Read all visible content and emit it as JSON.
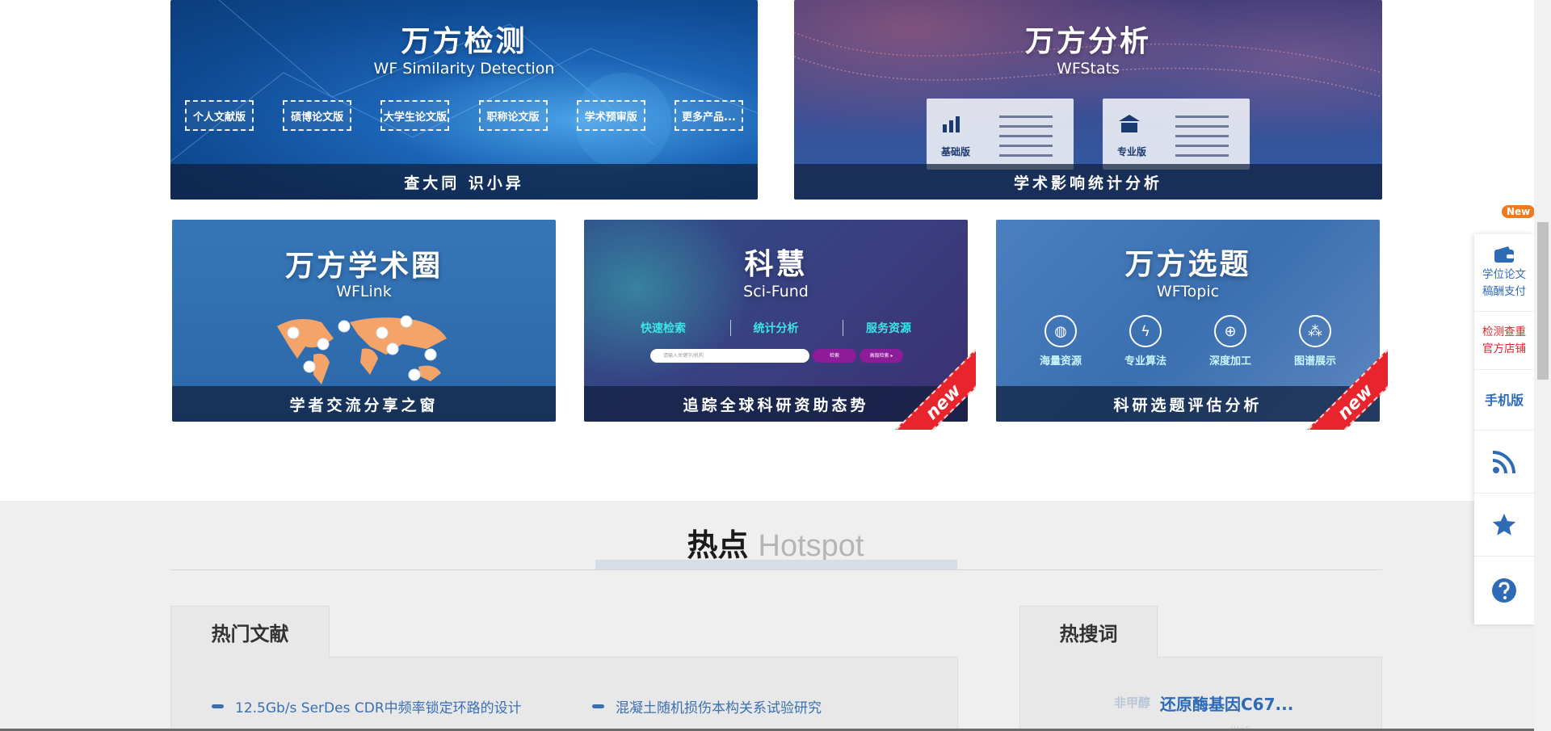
{
  "cards": {
    "detect": {
      "title": "万方检测",
      "subtitle": "WF Similarity Detection",
      "caption": "查大同 识小异",
      "buttons": [
        "个人文献版",
        "硕博论文版",
        "大学生论文版",
        "职称论文版",
        "学术预审版",
        "更多产品..."
      ]
    },
    "stats": {
      "title": "万方分析",
      "subtitle": "WFStats",
      "caption": "学术影响统计分析",
      "versions": [
        "基础版",
        "专业版"
      ]
    },
    "link": {
      "title": "万方学术圈",
      "subtitle": "WFLink",
      "caption": "学者交流分享之窗"
    },
    "fund": {
      "title": "科慧",
      "subtitle": "Sci-Fund",
      "caption": "追踪全球科研资助态势",
      "links": [
        "快速检索",
        "统计分析",
        "服务资源"
      ],
      "search_placeholder": "请输入关键字/机构",
      "search_btn": "检索",
      "adv_btn": "高级检索 ▸",
      "ribbon": "new"
    },
    "topic": {
      "title": "万方选题",
      "subtitle": "WFTopic",
      "caption": "科研选题评估分析",
      "items": [
        "海量资源",
        "专业算法",
        "深度加工",
        "图谱展示"
      ],
      "ribbon": "new"
    }
  },
  "hotspot": {
    "title_cn": "热点",
    "title_en": "Hotspot",
    "docs_tab": "热门文献",
    "docs": [
      "12.5Gb/s SerDes CDR中频率锁定环路的设计",
      "混凝土随机损伤本构关系试验研究"
    ],
    "hot_tab": "热搜词",
    "hot_ghost": "非甲醇",
    "hot_word": "还原酶基因C67...",
    "hot_ghost2": "半桥"
  },
  "float_bar": {
    "pay": "学位论文稿酬支付",
    "shop": "检测查重官方店铺",
    "mobile": "手机版",
    "new_badge": "New"
  },
  "colors": {
    "accent_blue": "#2f6bb5",
    "accent_red": "#d6262a",
    "ribbon_red": "#e8242c",
    "badge_orange": "#f07a1f"
  }
}
